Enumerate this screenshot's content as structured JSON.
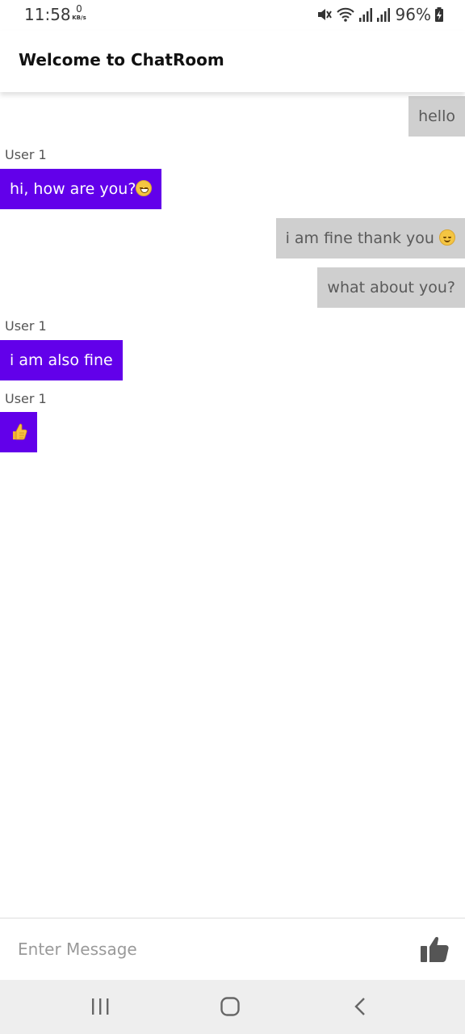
{
  "status_bar": {
    "time": "11:58",
    "net_speed_value": "0",
    "net_speed_unit": "KB/s",
    "battery": "96%"
  },
  "header": {
    "title": "Welcome to ChatRoom"
  },
  "messages": [
    {
      "type": "sent",
      "text": "hello"
    },
    {
      "type": "received",
      "sender": "User 1",
      "text": "hi, how are you?",
      "emoji": "grinning-face-emoji"
    },
    {
      "type": "sent",
      "text": "i am fine thank you ",
      "emoji": "smiling-face-emoji"
    },
    {
      "type": "sent",
      "text": "what about you?"
    },
    {
      "type": "received",
      "sender": "User 1",
      "text": "i am also fine"
    },
    {
      "type": "received",
      "sender": "User 1",
      "text": "",
      "emoji": "thumbs-up-emoji"
    }
  ],
  "composer": {
    "placeholder": "Enter Message",
    "value": "",
    "send_icon": "thumbs-up-icon"
  },
  "nav_bar": {
    "icons": [
      "recent-apps-icon",
      "home-icon",
      "back-icon"
    ]
  },
  "colors": {
    "received_bubble": "#6200ea",
    "sent_bubble": "#cfcfcf",
    "sent_text": "#5a5a5a"
  }
}
